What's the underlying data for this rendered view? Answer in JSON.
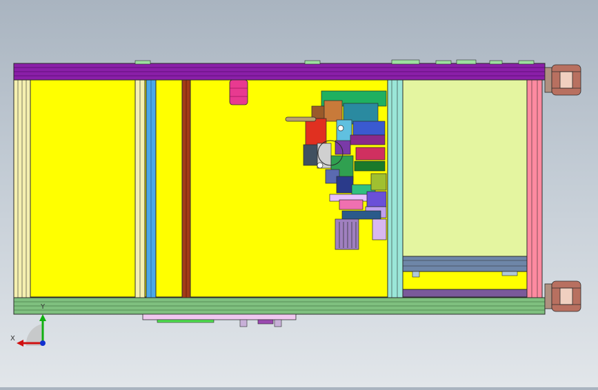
{
  "viewport": {
    "model": "machine-frame-assembly",
    "view": "top",
    "background_colors": [
      "#a9b4c0",
      "#e2e6ea"
    ]
  },
  "triad": {
    "x_label": "X",
    "y_label": "Y",
    "x_color": "#d01010",
    "y_color": "#10b010",
    "z_color": "#1030d0"
  },
  "colors": {
    "frame_top": "#8a1fa8",
    "frame_bottom": "#7fc07f",
    "base_plate": "#ffff00",
    "right_panel": "#e4f5a0",
    "right_post": "#ff8aa0",
    "left_post": "#f5f0b0",
    "blue_bar": "#4aa8e8",
    "brown_bar": "#a33a18",
    "cylinder": "#e83a90",
    "wheel": "#b87060"
  }
}
